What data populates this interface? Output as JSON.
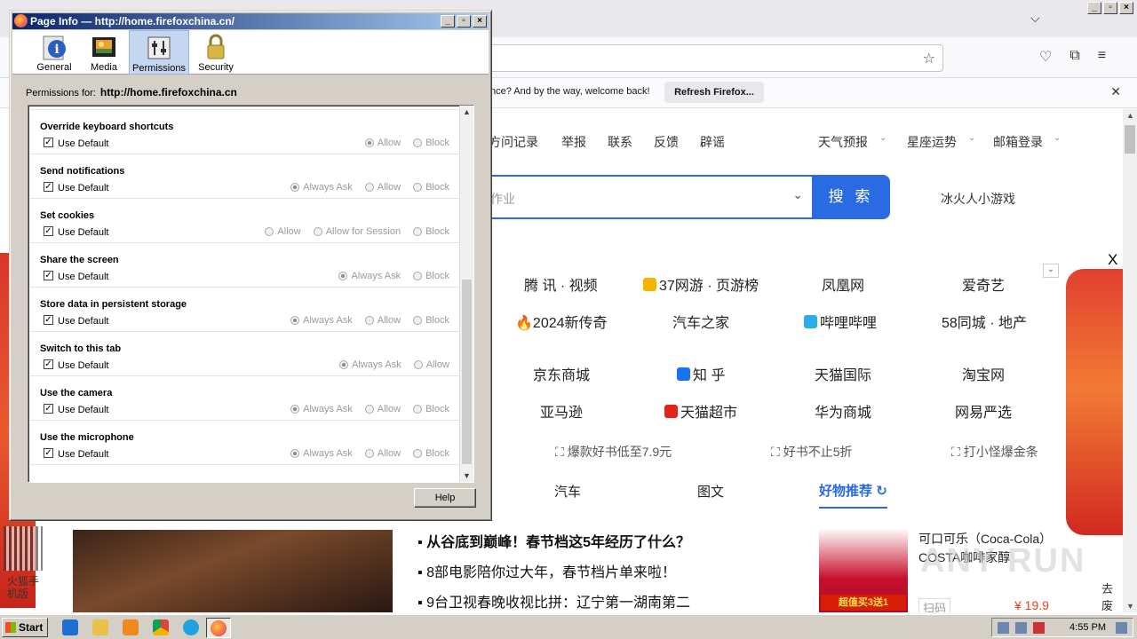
{
  "firefox": {
    "notification": {
      "message": "nce? And by the way, welcome back!",
      "refresh_label": "Refresh Firefox..."
    }
  },
  "website": {
    "top_links": [
      "方问记录",
      "举报",
      "联系",
      "反馈",
      "辟谣"
    ],
    "top_dropdowns": [
      "天气预报",
      "星座运势",
      "邮箱登录"
    ],
    "search_placeholder": "作业",
    "search_button": "搜 索",
    "game_link": "冰火人小游戏",
    "close_x": "X",
    "sites": [
      [
        "腾 讯 · 视频",
        "37网游 · 页游榜",
        "凤凰网",
        "爱奇艺"
      ],
      [
        "2024新传奇",
        "汽车之家",
        "哔哩哔哩",
        "58同城 · 地产"
      ],
      [
        "京东商城",
        "知 乎",
        "天猫国际",
        "淘宝网"
      ],
      [
        "亚马逊",
        "天猫超市",
        "华为商城",
        "网易严选"
      ]
    ],
    "promos": [
      "爆款好书低至7.9元",
      "好书不止5折",
      "打小怪爆金条"
    ],
    "tabs": [
      "汽车",
      "图文"
    ],
    "haowu_label": "好物推荐",
    "news": [
      "从谷底到巅峰！春节档这5年经历了什么？",
      "8部电影陪你过大年，春节档片单来啦！",
      "9台卫视春晚收视比拼：辽宁第一湖南第二"
    ],
    "qr_label": "火狐手机版",
    "product": {
      "name": "可口可乐（Coca-Cola）COSTA咖啡家醇",
      "promo_tag": "超值买3送1",
      "scan_label": "扫码",
      "price": "¥ 19.9"
    },
    "side_text": "去废",
    "watermark": "ANY RUN"
  },
  "dialog": {
    "title": "Page Info — http://home.firefoxchina.cn/",
    "tabs": [
      "General",
      "Media",
      "Permissions",
      "Security"
    ],
    "selected_tab": "Permissions",
    "permissions_for_label": "Permissions for:",
    "permissions_for_url": "http://home.firefoxchina.cn",
    "use_default_label": "Use Default",
    "permissions": [
      {
        "name": "",
        "options": [
          {
            "label": "Allow",
            "selected": false
          },
          {
            "label": "Block",
            "selected": true
          }
        ]
      },
      {
        "name": "Override keyboard shortcuts",
        "options": [
          {
            "label": "Allow",
            "selected": true
          },
          {
            "label": "Block",
            "selected": false
          }
        ]
      },
      {
        "name": "Send notifications",
        "options": [
          {
            "label": "Always Ask",
            "selected": true
          },
          {
            "label": "Allow",
            "selected": false
          },
          {
            "label": "Block",
            "selected": false
          }
        ]
      },
      {
        "name": "Set cookies",
        "options": [
          {
            "label": "Allow",
            "selected": false
          },
          {
            "label": "Allow for Session",
            "selected": false
          },
          {
            "label": "Block",
            "selected": false
          }
        ]
      },
      {
        "name": "Share the screen",
        "options": [
          {
            "label": "Always Ask",
            "selected": true
          },
          {
            "label": "Block",
            "selected": false
          }
        ]
      },
      {
        "name": "Store data in persistent storage",
        "options": [
          {
            "label": "Always Ask",
            "selected": true
          },
          {
            "label": "Allow",
            "selected": false
          },
          {
            "label": "Block",
            "selected": false
          }
        ]
      },
      {
        "name": "Switch to this tab",
        "options": [
          {
            "label": "Always Ask",
            "selected": true
          },
          {
            "label": "Allow",
            "selected": false
          }
        ]
      },
      {
        "name": "Use the camera",
        "options": [
          {
            "label": "Always Ask",
            "selected": true
          },
          {
            "label": "Allow",
            "selected": false
          },
          {
            "label": "Block",
            "selected": false
          }
        ]
      },
      {
        "name": "Use the microphone",
        "options": [
          {
            "label": "Always Ask",
            "selected": true
          },
          {
            "label": "Allow",
            "selected": false
          },
          {
            "label": "Block",
            "selected": false
          }
        ]
      }
    ],
    "help_label": "Help"
  },
  "taskbar": {
    "start_label": "Start",
    "clock": "4:55 PM"
  },
  "colors": {
    "accent": "#2a6ae3",
    "titlebar": "#0a246a",
    "price": "#e53f1e"
  }
}
